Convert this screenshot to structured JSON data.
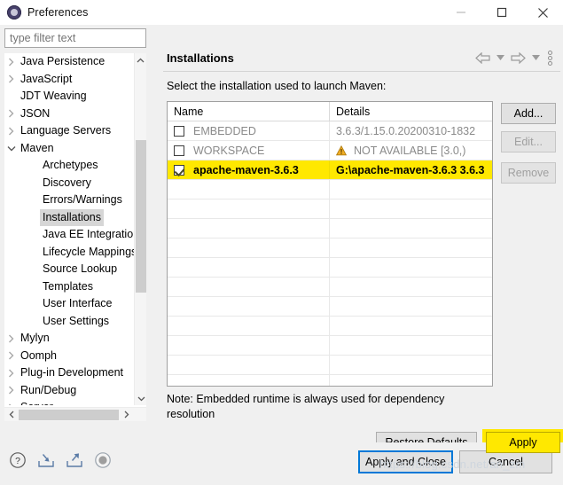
{
  "window": {
    "title": "Preferences",
    "icon": "preferences-icon",
    "minimize_label": "Minimize",
    "maximize_label": "Maximize",
    "close_label": "Close"
  },
  "filter": {
    "placeholder": "type filter text",
    "value": ""
  },
  "tree": {
    "items": [
      {
        "label": "Java Persistence",
        "indent": 0,
        "arrow": "collapsed",
        "selected": false
      },
      {
        "label": "JavaScript",
        "indent": 0,
        "arrow": "collapsed",
        "selected": false
      },
      {
        "label": "JDT Weaving",
        "indent": 0,
        "arrow": "none",
        "selected": false
      },
      {
        "label": "JSON",
        "indent": 0,
        "arrow": "collapsed",
        "selected": false
      },
      {
        "label": "Language Servers",
        "indent": 0,
        "arrow": "collapsed",
        "selected": false
      },
      {
        "label": "Maven",
        "indent": 0,
        "arrow": "expanded",
        "selected": false
      },
      {
        "label": "Archetypes",
        "indent": 1,
        "arrow": "none",
        "selected": false
      },
      {
        "label": "Discovery",
        "indent": 1,
        "arrow": "none",
        "selected": false
      },
      {
        "label": "Errors/Warnings",
        "indent": 1,
        "arrow": "none",
        "selected": false
      },
      {
        "label": "Installations",
        "indent": 1,
        "arrow": "none",
        "selected": true
      },
      {
        "label": "Java EE Integration",
        "indent": 1,
        "arrow": "none",
        "selected": false
      },
      {
        "label": "Lifecycle Mappings",
        "indent": 1,
        "arrow": "none",
        "selected": false
      },
      {
        "label": "Source Lookup",
        "indent": 1,
        "arrow": "none",
        "selected": false
      },
      {
        "label": "Templates",
        "indent": 1,
        "arrow": "none",
        "selected": false
      },
      {
        "label": "User Interface",
        "indent": 1,
        "arrow": "none",
        "selected": false
      },
      {
        "label": "User Settings",
        "indent": 1,
        "arrow": "none",
        "selected": false
      },
      {
        "label": "Mylyn",
        "indent": 0,
        "arrow": "collapsed",
        "selected": false
      },
      {
        "label": "Oomph",
        "indent": 0,
        "arrow": "collapsed",
        "selected": false
      },
      {
        "label": "Plug-in Development",
        "indent": 0,
        "arrow": "collapsed",
        "selected": false
      },
      {
        "label": "Run/Debug",
        "indent": 0,
        "arrow": "collapsed",
        "selected": false
      },
      {
        "label": "Server",
        "indent": 0,
        "arrow": "collapsed",
        "selected": false
      }
    ]
  },
  "page": {
    "title": "Installations",
    "instruction": "Select the installation used to launch Maven:",
    "note": "Note: Embedded runtime is always used for dependency resolution"
  },
  "nav": {
    "back_icon": "arrow-left-icon",
    "back_dropdown_icon": "chevron-down-icon",
    "forward_icon": "arrow-right-icon",
    "forward_dropdown_icon": "chevron-down-icon",
    "menu_icon": "vertical-dots-icon"
  },
  "table": {
    "columns": [
      "Name",
      "Details"
    ],
    "rows": [
      {
        "checked": false,
        "name": "EMBEDDED",
        "details": "3.6.3/1.15.0.20200310-1832",
        "warning": false,
        "highlighted": false,
        "enabled": false
      },
      {
        "checked": false,
        "name": "WORKSPACE",
        "details": "NOT AVAILABLE [3.0,)",
        "warning": true,
        "warning_icon": "warning-triangle-icon",
        "highlighted": false,
        "enabled": false
      },
      {
        "checked": true,
        "name": "apache-maven-3.6.3",
        "details": "G:\\apache-maven-3.6.3 3.6.3",
        "warning": false,
        "highlighted": true,
        "enabled": true
      }
    ],
    "empty_row_count": 11
  },
  "side_buttons": {
    "add": "Add...",
    "edit": "Edit...",
    "remove": "Remove"
  },
  "actions": {
    "restore_defaults": "Restore Defaults",
    "apply": "Apply",
    "apply_and_close": "Apply and Close",
    "cancel": "Cancel"
  },
  "footer_icons": [
    {
      "name": "help-icon",
      "glyph": "?"
    },
    {
      "name": "import-icon",
      "glyph": "import"
    },
    {
      "name": "export-icon",
      "glyph": "export"
    },
    {
      "name": "record-icon",
      "glyph": "circle"
    }
  ],
  "watermark": "https://blog.csdn.net/an_zm",
  "colors": {
    "highlight": "#ffe800",
    "focus_border": "#0078d7",
    "selection": "#d6d6d6",
    "warning": "#e8a317"
  }
}
